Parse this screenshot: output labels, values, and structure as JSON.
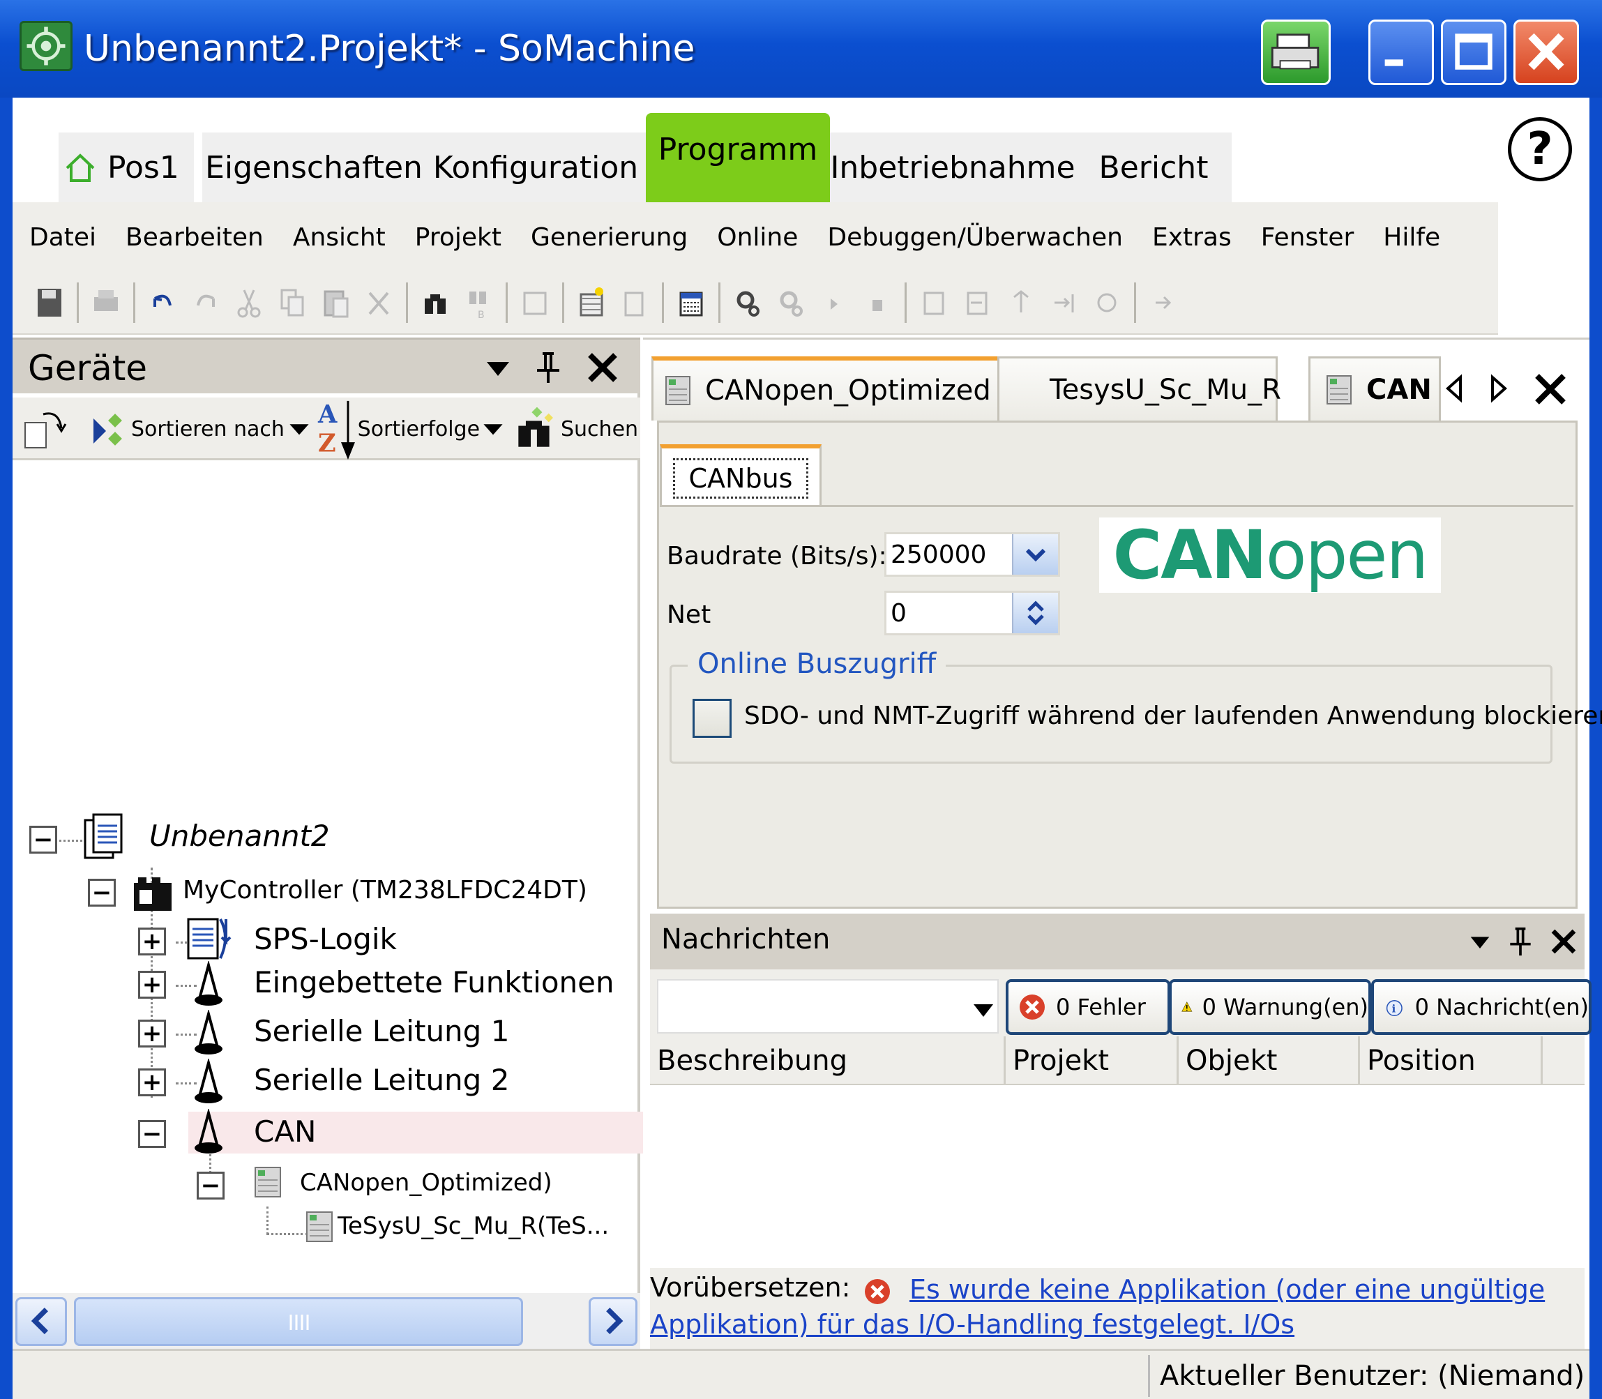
{
  "window": {
    "title": "Unbenannt2.Projekt* - SoMachine"
  },
  "ribbon": {
    "tabs": [
      {
        "label": "Pos1",
        "icon": "home-icon"
      },
      {
        "label": "Eigenschaften"
      },
      {
        "label": "Konfiguration"
      },
      {
        "label": "Programm",
        "active": true
      },
      {
        "label": "Inbetriebnahme"
      },
      {
        "label": "Bericht"
      }
    ],
    "active_color": "#7dcc1a",
    "help": "?"
  },
  "menubar": {
    "items": [
      "Datei",
      "Bearbeiten",
      "Ansicht",
      "Projekt",
      "Generierung",
      "Online",
      "Debuggen/Überwachen",
      "Extras",
      "Fenster",
      "Hilfe"
    ]
  },
  "toolbar": {
    "icons": [
      "save-icon",
      "print-icon",
      "undo-icon",
      "redo-icon",
      "cut-icon",
      "copy-icon",
      "paste-icon",
      "delete-icon",
      "find-icon",
      "replace-icon",
      "window-icon",
      "build-icon",
      "page-icon",
      "calendar-icon",
      "settings-icon",
      "settings-disabled-icon",
      "play-icon",
      "stop-icon",
      "step-over-icon",
      "step-into-icon",
      "step-out-icon",
      "run-to-cursor-icon",
      "breakpoint-icon",
      "forward-icon"
    ]
  },
  "devices": {
    "title": "Geräte",
    "toolbar": {
      "sort_by": "Sortieren nach",
      "sort_order": "Sortierfolge",
      "search": "Suchen"
    },
    "tree": {
      "root": "Unbenannt2",
      "controller": "MyController (TM238LFDC24DT)",
      "children": [
        "SPS-Logik",
        "Eingebettete Funktionen",
        "Serielle Leitung 1",
        "Serielle Leitung 2",
        "CAN"
      ],
      "can_child": "CANopen_Optimized)",
      "can_grandchild": "TeSysU_Sc_Mu_R(TeS..."
    }
  },
  "editor": {
    "tabs": [
      "CANopen_Optimized",
      "TesysU_Sc_Mu_R",
      "CAN"
    ],
    "active_tab": "CANopen_Optimized",
    "subtab": "CANbus",
    "baudrate_label": "Baudrate (Bits/s):",
    "baudrate_value": "250000",
    "net_label": "Net",
    "net_value": "0",
    "logo_bold": "CAN",
    "logo_light": "open",
    "logo_color": "#1d9a74",
    "group_title": "Online Buszugriff",
    "checkbox_label": "SDO- und NMT-Zugriff während der laufenden Anwendung blockieren",
    "checkbox_checked": false
  },
  "messages": {
    "title": "Nachrichten",
    "filter_value": "",
    "errors": "0 Fehler",
    "warnings": "0 Warnung(en)",
    "infos": "0 Nachricht(en)",
    "columns": [
      "Beschreibung",
      "Projekt",
      "Objekt",
      "Position"
    ],
    "status_prefix": "Vorübersetzen:",
    "status_link": "Es wurde keine Applikation (oder eine ungültige Applikation) für das I/O-Handling festgelegt. I/Os"
  },
  "statusbar": {
    "user": "Aktueller Benutzer: (Niemand)"
  }
}
